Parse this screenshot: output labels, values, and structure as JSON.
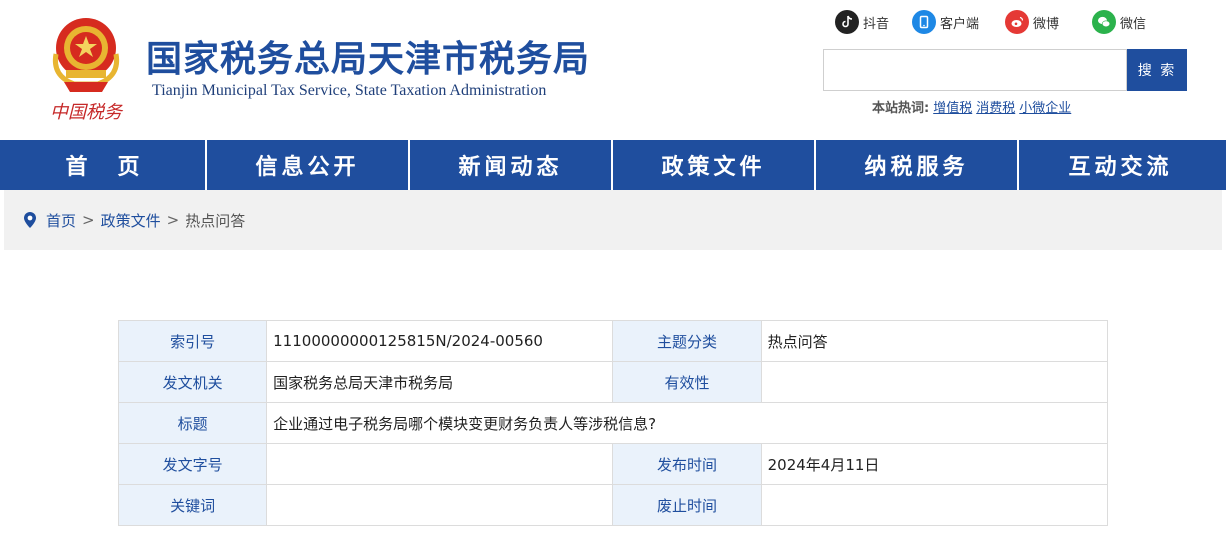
{
  "header": {
    "title": "国家税务总局天津市税务局",
    "subtitle": "Tianjin Municipal Tax Service, State Taxation Administration",
    "logo_text": "中国税务"
  },
  "social": [
    {
      "label": "抖音",
      "icon": "douyin-icon",
      "color": "#222222"
    },
    {
      "label": "客户端",
      "icon": "mobile-client-icon",
      "color": "#1e88e5"
    },
    {
      "label": "微博",
      "icon": "weibo-icon",
      "color": "#e53935"
    },
    {
      "label": "微信",
      "icon": "wechat-icon",
      "color": "#2bb24c"
    }
  ],
  "search": {
    "placeholder": "",
    "button_label": "搜 索"
  },
  "hot": {
    "label": "本站热词:",
    "terms": [
      "增值税",
      "消费税",
      "小微企业"
    ]
  },
  "nav": [
    "首　页",
    "信息公开",
    "新闻动态",
    "政策文件",
    "纳税服务",
    "互动交流"
  ],
  "breadcrumb": {
    "items": [
      "首页",
      "政策文件",
      "热点问答"
    ],
    "separator": ">"
  },
  "info_table": {
    "index_label": "索引号",
    "index_value": "11100000000125815N/2024-00560",
    "topic_label": "主题分类",
    "topic_value": "热点问答",
    "issuer_label": "发文机关",
    "issuer_value": "国家税务总局天津市税务局",
    "validity_label": "有效性",
    "validity_value": "",
    "title_label": "标题",
    "title_value": "企业通过电子税务局哪个模块变更财务负责人等涉税信息?",
    "docno_label": "发文字号",
    "docno_value": "",
    "pubdate_label": "发布时间",
    "pubdate_value": "2024年4月11日",
    "keywords_label": "关键词",
    "keywords_value": "",
    "expiry_label": "废止时间",
    "expiry_value": ""
  },
  "colors": {
    "brand_blue": "#1f4e9e",
    "label_bg": "#eaf2fb",
    "breadcrumb_bg": "#f1f1f1"
  }
}
